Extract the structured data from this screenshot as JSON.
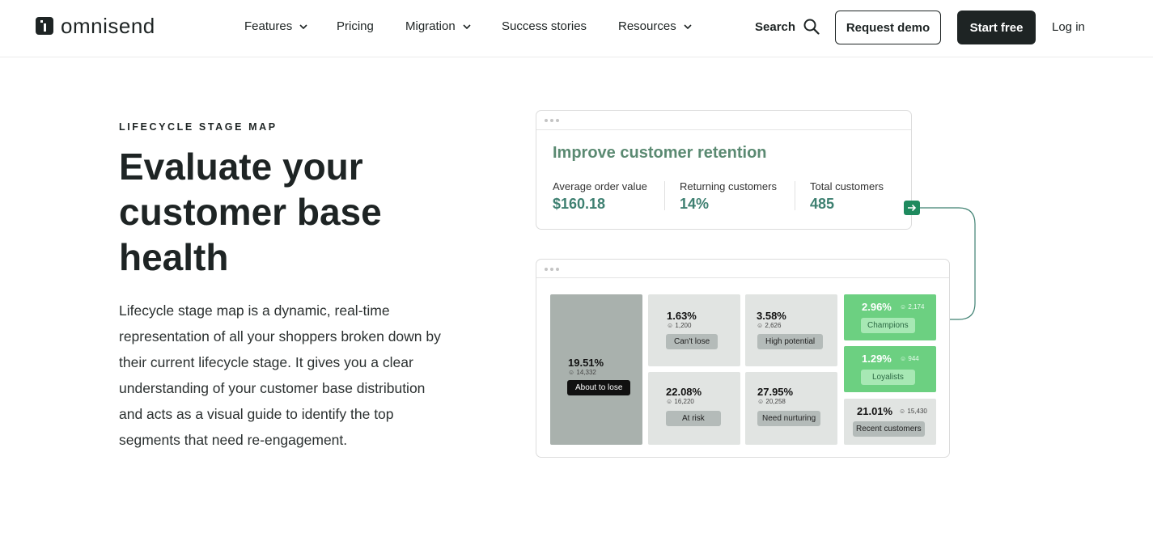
{
  "brand": {
    "name": "omnisend"
  },
  "nav": {
    "items": [
      {
        "label": "Features",
        "dropdown": true
      },
      {
        "label": "Pricing",
        "dropdown": false
      },
      {
        "label": "Migration",
        "dropdown": true
      },
      {
        "label": "Success stories",
        "dropdown": false
      },
      {
        "label": "Resources",
        "dropdown": true
      }
    ],
    "search_label": "Search",
    "request_demo": "Request demo",
    "start_free": "Start free",
    "login": "Log in"
  },
  "hero": {
    "eyebrow": "LIFECYCLE STAGE MAP",
    "headline_lines": [
      "Evaluate your",
      "customer base",
      "health"
    ],
    "body_lines": [
      "Lifecycle stage map is a dynamic, real-time",
      "representation of all your shoppers broken down by",
      "their current lifecycle stage. It gives you a clear",
      "understanding of your customer base distribution",
      "and acts as a visual guide to identify the top",
      "segments that need re-engagement."
    ]
  },
  "retention_card": {
    "title": "Improve customer retention",
    "metrics": [
      {
        "label": "Average order value",
        "value": "$160.18"
      },
      {
        "label": "Returning customers",
        "value": "14%"
      },
      {
        "label": "Total customers",
        "value": "485"
      }
    ]
  },
  "stage_map": {
    "tiles": [
      {
        "pct": "19.51%",
        "count": "14,332",
        "label": "About to lose"
      },
      {
        "pct": "1.63%",
        "count": "1,200",
        "label": "Can't lose"
      },
      {
        "pct": "3.58%",
        "count": "2,626",
        "label": "High potential"
      },
      {
        "pct": "2.96%",
        "count": "2,174",
        "label": "Champions"
      },
      {
        "pct": "1.29%",
        "count": "944",
        "label": "Loyalists"
      },
      {
        "pct": "22.08%",
        "count": "16,220",
        "label": "At risk"
      },
      {
        "pct": "27.95%",
        "count": "20,258",
        "label": "Need nurturing"
      },
      {
        "pct": "21.01%",
        "count": "15,430",
        "label": "Recent customers"
      }
    ]
  },
  "colors": {
    "dark": "#1e2424",
    "accent_green": "#3e8071",
    "tile_green": "#6cd081",
    "tile_gray": "#e1e4e2",
    "tile_dark_gray": "#a9b1ad"
  }
}
